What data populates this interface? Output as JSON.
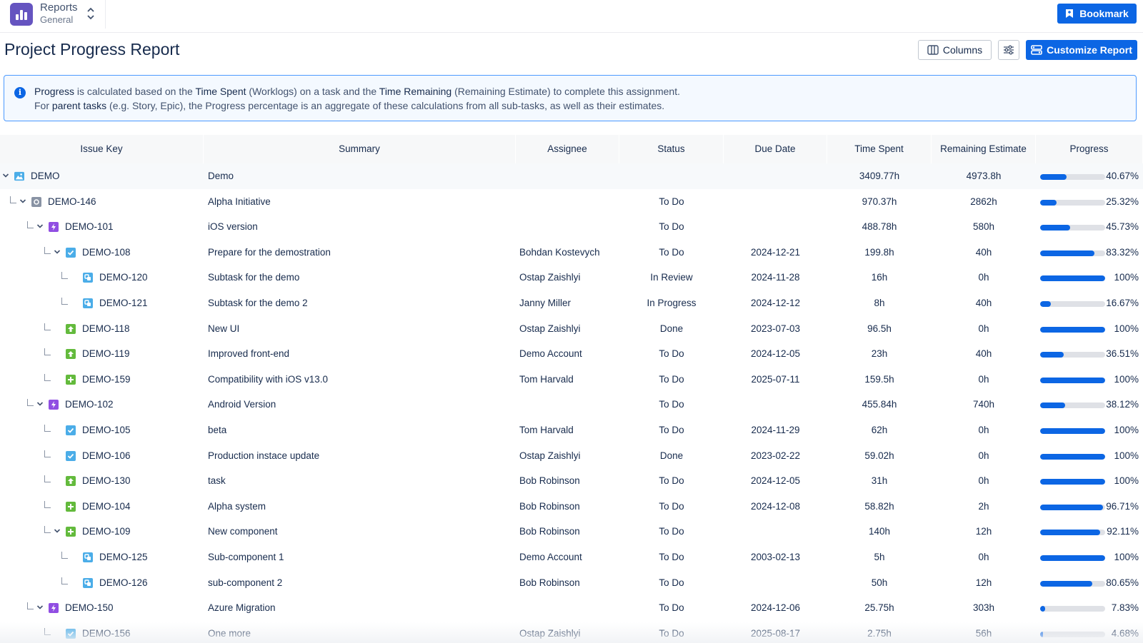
{
  "app": {
    "title": "Reports",
    "subtitle": "General"
  },
  "toolbar": {
    "bookmark_label": "Bookmark"
  },
  "page": {
    "title": "Project Progress Report"
  },
  "actions": {
    "columns_label": "Columns",
    "customize_label": "Customize Report"
  },
  "info": {
    "line1": [
      {
        "t": "Progress",
        "b": true
      },
      {
        "t": " is calculated based on the ",
        "b": false
      },
      {
        "t": "Time Spent",
        "b": true
      },
      {
        "t": " (Worklogs) on a task and the ",
        "b": false
      },
      {
        "t": "Time Remaining",
        "b": true
      },
      {
        "t": " (Remaining Estimate) to complete this assignment.",
        "b": false
      }
    ],
    "line2": [
      {
        "t": "For ",
        "b": false
      },
      {
        "t": "parent tasks",
        "b": true
      },
      {
        "t": " (e.g. Story, Epic), the Progress percentage is an aggregate of these calculations from all sub-tasks, as well as their estimates.",
        "b": false
      }
    ]
  },
  "colors": {
    "accent": "#0c66e4",
    "epic": "#904ee2",
    "subtask": "#4bade8",
    "task": "#4bade8",
    "story": "#63ba3c",
    "new_feature": "#63ba3c",
    "initiative": "#8993a4",
    "project": "#4bade8"
  },
  "table": {
    "headers": [
      "Issue Key",
      "Summary",
      "Assignee",
      "Status",
      "Due Date",
      "Time Spent",
      "Remaining Estimate",
      "Progress"
    ],
    "rows": [
      {
        "key": "DEMO",
        "level": 0,
        "type": "project-icon",
        "expanded": true,
        "summary": "Demo",
        "assignee": "",
        "status": "",
        "due": "",
        "spent": "3409.77h",
        "remaining": "4973.8h",
        "progress": 40.67,
        "progress_label": "40.67%"
      },
      {
        "key": "DEMO-146",
        "level": 1,
        "type": "initiative-icon",
        "expanded": true,
        "summary": "Alpha Initiative",
        "assignee": "",
        "status": "To Do",
        "due": "",
        "spent": "970.37h",
        "remaining": "2862h",
        "progress": 25.32,
        "progress_label": "25.32%"
      },
      {
        "key": "DEMO-101",
        "level": 2,
        "type": "epic-icon",
        "expanded": true,
        "summary": "iOS version",
        "assignee": "",
        "status": "To Do",
        "due": "",
        "spent": "488.78h",
        "remaining": "580h",
        "progress": 45.73,
        "progress_label": "45.73%"
      },
      {
        "key": "DEMO-108",
        "level": 3,
        "type": "task-icon",
        "expanded": true,
        "summary": "Prepare for the demostration",
        "assignee": "Bohdan Kostevych",
        "status": "To Do",
        "due": "2024-12-21",
        "spent": "199.8h",
        "remaining": "40h",
        "progress": 83.32,
        "progress_label": "83.32%"
      },
      {
        "key": "DEMO-120",
        "level": 4,
        "type": "subtask-icon",
        "expanded": null,
        "summary": "Subtask for the demo",
        "assignee": "Ostap Zaishlyi",
        "status": "In Review",
        "due": "2024-11-28",
        "spent": "16h",
        "remaining": "0h",
        "progress": 100,
        "progress_label": "100%"
      },
      {
        "key": "DEMO-121",
        "level": 4,
        "type": "subtask-icon",
        "expanded": null,
        "summary": "Subtask for the demo 2",
        "assignee": "Janny Miller",
        "status": "In Progress",
        "due": "2024-12-12",
        "spent": "8h",
        "remaining": "40h",
        "progress": 16.67,
        "progress_label": "16.67%"
      },
      {
        "key": "DEMO-118",
        "level": 3,
        "type": "improvement-icon",
        "expanded": null,
        "summary": "New UI",
        "assignee": "Ostap Zaishlyi",
        "status": "Done",
        "due": "2023-07-03",
        "spent": "96.5h",
        "remaining": "0h",
        "progress": 100,
        "progress_label": "100%"
      },
      {
        "key": "DEMO-119",
        "level": 3,
        "type": "improvement-icon",
        "expanded": null,
        "summary": "Improved front-end",
        "assignee": "Demo Account",
        "status": "To Do",
        "due": "2024-12-05",
        "spent": "23h",
        "remaining": "40h",
        "progress": 36.51,
        "progress_label": "36.51%"
      },
      {
        "key": "DEMO-159",
        "level": 3,
        "type": "new-feature-icon",
        "expanded": null,
        "summary": "Compatibility with iOS v13.0",
        "assignee": "Tom Harvald",
        "status": "To Do",
        "due": "2025-07-11",
        "spent": "159.5h",
        "remaining": "0h",
        "progress": 100,
        "progress_label": "100%"
      },
      {
        "key": "DEMO-102",
        "level": 2,
        "type": "epic-icon",
        "expanded": true,
        "summary": "Android Version",
        "assignee": "",
        "status": "To Do",
        "due": "",
        "spent": "455.84h",
        "remaining": "740h",
        "progress": 38.12,
        "progress_label": "38.12%"
      },
      {
        "key": "DEMO-105",
        "level": 3,
        "type": "task-icon",
        "expanded": null,
        "summary": "beta",
        "assignee": "Tom Harvald",
        "status": "To Do",
        "due": "2024-11-29",
        "spent": "62h",
        "remaining": "0h",
        "progress": 100,
        "progress_label": "100%"
      },
      {
        "key": "DEMO-106",
        "level": 3,
        "type": "task-icon",
        "expanded": null,
        "summary": "Production instace update",
        "assignee": "Ostap Zaishlyi",
        "status": "Done",
        "due": "2023-02-22",
        "spent": "59.02h",
        "remaining": "0h",
        "progress": 100,
        "progress_label": "100%"
      },
      {
        "key": "DEMO-130",
        "level": 3,
        "type": "improvement-icon",
        "expanded": null,
        "summary": "task",
        "assignee": "Bob Robinson",
        "status": "To Do",
        "due": "2024-12-05",
        "spent": "31h",
        "remaining": "0h",
        "progress": 100,
        "progress_label": "100%"
      },
      {
        "key": "DEMO-104",
        "level": 3,
        "type": "new-feature-icon",
        "expanded": null,
        "summary": "Alpha system",
        "assignee": "Bob Robinson",
        "status": "To Do",
        "due": "2024-12-08",
        "spent": "58.82h",
        "remaining": "2h",
        "progress": 96.71,
        "progress_label": "96.71%"
      },
      {
        "key": "DEMO-109",
        "level": 3,
        "type": "new-feature-icon",
        "expanded": true,
        "summary": "New component",
        "assignee": "Bob Robinson",
        "status": "To Do",
        "due": "",
        "spent": "140h",
        "remaining": "12h",
        "progress": 92.11,
        "progress_label": "92.11%"
      },
      {
        "key": "DEMO-125",
        "level": 4,
        "type": "subtask-icon",
        "expanded": null,
        "summary": "Sub-component 1",
        "assignee": "Demo Account",
        "status": "To Do",
        "due": "2003-02-13",
        "spent": "5h",
        "remaining": "0h",
        "progress": 100,
        "progress_label": "100%"
      },
      {
        "key": "DEMO-126",
        "level": 4,
        "type": "subtask-icon",
        "expanded": null,
        "summary": "sub-component 2",
        "assignee": "Bob Robinson",
        "status": "To Do",
        "due": "",
        "spent": "50h",
        "remaining": "12h",
        "progress": 80.65,
        "progress_label": "80.65%"
      },
      {
        "key": "DEMO-150",
        "level": 2,
        "type": "epic-icon",
        "expanded": true,
        "summary": "Azure Migration",
        "assignee": "",
        "status": "To Do",
        "due": "2024-12-06",
        "spent": "25.75h",
        "remaining": "303h",
        "progress": 7.83,
        "progress_label": "7.83%"
      },
      {
        "key": "DEMO-156",
        "level": 3,
        "type": "task-icon",
        "expanded": null,
        "summary": "One more",
        "assignee": "Ostap Zaishlyi",
        "status": "To Do",
        "due": "2025-08-17",
        "spent": "2.75h",
        "remaining": "56h",
        "progress": 4.68,
        "progress_label": "4.68%"
      }
    ]
  }
}
